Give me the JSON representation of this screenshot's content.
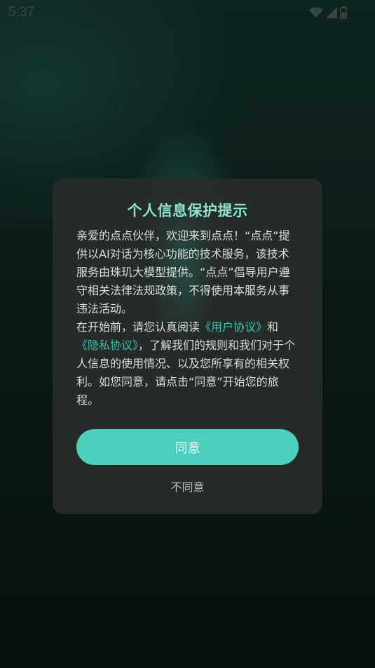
{
  "status_bar": {
    "time": "5:37",
    "icons": [
      "wifi-icon",
      "signal-icon",
      "battery-icon"
    ]
  },
  "dialog": {
    "title": "个人信息保护提示",
    "paragraph1": "亲爱的点点伙伴，欢迎来到点点！“点点”提供以AI对话为核心功能的技术服务，该技术服务由珠玑大模型提供。“点点”倡导用户遵守相关法律法规政策，不得使用本服务从事违法活动。",
    "paragraph2_prefix": "在开始前，请您认真阅读",
    "user_agreement_link": "《用户协议》",
    "paragraph2_and": "和",
    "privacy_agreement_link": "《隐私协议》",
    "paragraph2_suffix": "，了解我们的规则和我们对于个人信息的使用情况、以及您所享有的相关权利。如您同意，请点击“同意”开始您的旅程。",
    "agree_label": "同意",
    "disagree_label": "不同意"
  },
  "colors": {
    "title": "#8fe3cf",
    "link": "#35c2ad",
    "button": "#4dcfbf",
    "dialog_bg": "#262c2b"
  }
}
